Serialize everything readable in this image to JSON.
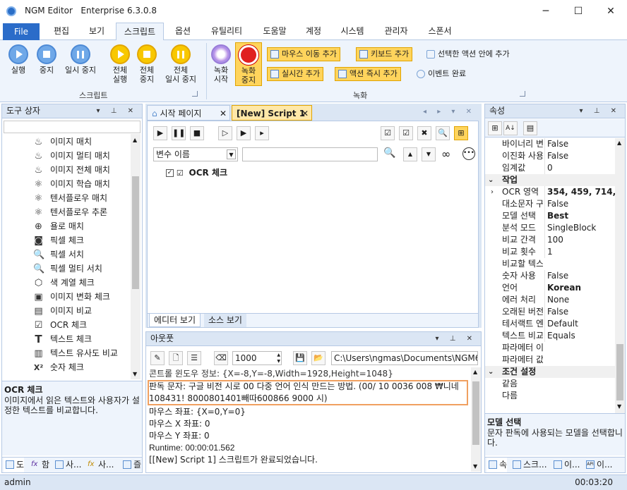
{
  "window": {
    "app": "NGM Editor",
    "edition": "Enterprise 6.3.0.8"
  },
  "window_controls": {
    "minimize": "─",
    "maximize": "☐",
    "close": "✕"
  },
  "menu": {
    "file": "File",
    "tabs": [
      "편집",
      "보기",
      "스크립트",
      "옵션",
      "유틸리티",
      "도움말",
      "계정",
      "시스템",
      "관리자",
      "스폰서"
    ],
    "active": "스크립트"
  },
  "ribbon": {
    "script_group": {
      "label": "스크립트",
      "buttons": [
        "실행",
        "중지",
        "일시 중지"
      ],
      "all_buttons": [
        [
          "전체",
          "실행"
        ],
        [
          "전체",
          "중지"
        ],
        [
          "전체",
          "일시 중지"
        ]
      ]
    },
    "record_group": {
      "label": "녹화",
      "rec_start": [
        "녹화",
        "시작"
      ],
      "rec_stop": [
        "녹화",
        "중지"
      ],
      "small": [
        "마우스 이동 추가",
        "키보드 추가",
        "실시간 추가",
        "액션 즉시 추가"
      ],
      "add_in_action": "선택한 액션 안에 추가",
      "event_done": "이벤트 완료"
    }
  },
  "toolbox": {
    "title": "도구 상자",
    "items": [
      {
        "icon": "♨",
        "label": "이미지 매치"
      },
      {
        "icon": "♨",
        "label": "이미지 멀티 매치"
      },
      {
        "icon": "♨",
        "label": "이미지 전체 매치"
      },
      {
        "icon": "⚛",
        "label": "이미지 학습 매치"
      },
      {
        "icon": "⚛",
        "label": "텐서플로우 매치"
      },
      {
        "icon": "⚛",
        "label": "텐서플로우 추론"
      },
      {
        "icon": "⊕",
        "label": "욜로 매치"
      },
      {
        "icon": "◙",
        "label": "픽셀 체크"
      },
      {
        "icon": "🔍",
        "label": "픽셀 서치"
      },
      {
        "icon": "🔍",
        "label": "픽셀 멀티 서치"
      },
      {
        "icon": "⬡",
        "label": "색 계열 체크"
      },
      {
        "icon": "▣",
        "label": "이미지 변화 체크"
      },
      {
        "icon": "▤",
        "label": "이미지 비교"
      },
      {
        "icon": "☑",
        "label": "OCR 체크"
      },
      {
        "icon": "T",
        "label": "텍스트 체크"
      },
      {
        "icon": "▥",
        "label": "텍스트 유사도 비교"
      },
      {
        "icon": "X²",
        "label": "숫자 체크"
      }
    ],
    "desc_title": "OCR 체크",
    "desc_text": "이미지에서 읽은 텍스트와 사용자가 설정한 텍스트를 비교합니다.",
    "bottom_tabs": [
      "도",
      "함",
      "사...",
      "사...",
      "즐"
    ]
  },
  "editor": {
    "tabs": [
      {
        "label": "시작 페이지"
      },
      {
        "label": "[New] Script 1"
      }
    ],
    "var_select": "변수 이름",
    "node": "OCR 체크",
    "view_tabs": [
      "에디터 보기",
      "소스 보기"
    ]
  },
  "output": {
    "title": "아웃풋",
    "count": "1000",
    "path": "C:\\Users\\ngmas\\Documents\\NGM6\\",
    "lines": [
      "콘트롤 윈도우 정보: {X=-8,Y=-8,Width=1928,Height=1048}",
      "판독 문자: 구글 비전 시로 00 다중 언어 인식 만드는 방법. (00/ 10 0036 008 ₩니네",
      "108431! 8000801401빼따600866 9000 시)",
      "마우스 좌표: {X=0,Y=0}",
      "마우스 X 좌표: 0",
      "마우스 Y 좌표: 0",
      "Runtime: 00:00:01.562",
      "[[New] Script 1] 스크립트가 완료되었습니다."
    ]
  },
  "properties": {
    "title": "속성",
    "rows": [
      {
        "k": "바이너리 변",
        "v": "False",
        "type": "row"
      },
      {
        "k": "이진화 사용",
        "v": "False",
        "type": "row"
      },
      {
        "k": "임계값",
        "v": "0",
        "type": "row"
      },
      {
        "k": "작업",
        "v": "",
        "type": "cat"
      },
      {
        "k": "OCR 영역",
        "v": "354, 459, 714, 3",
        "type": "row",
        "bold": true,
        "arrow": true
      },
      {
        "k": "대소문자 구",
        "v": "False",
        "type": "row"
      },
      {
        "k": "모델 선택",
        "v": "Best",
        "type": "row",
        "bold": true
      },
      {
        "k": "분석 모드",
        "v": "SingleBlock",
        "type": "row"
      },
      {
        "k": "비교 간격",
        "v": "100",
        "type": "row"
      },
      {
        "k": "비교 횟수",
        "v": "1",
        "type": "row"
      },
      {
        "k": "비교할 텍스",
        "v": "",
        "type": "row"
      },
      {
        "k": "숫자 사용",
        "v": "False",
        "type": "row"
      },
      {
        "k": "언어",
        "v": "Korean",
        "type": "row",
        "bold": true
      },
      {
        "k": "에러 처리",
        "v": "None",
        "type": "row"
      },
      {
        "k": "오래된 버전",
        "v": "False",
        "type": "row"
      },
      {
        "k": "테서랙트 엔",
        "v": "Default",
        "type": "row"
      },
      {
        "k": "텍스트 비교",
        "v": "Equals",
        "type": "row"
      },
      {
        "k": "파라메터 이",
        "v": "",
        "type": "row"
      },
      {
        "k": "파라메터 값",
        "v": "",
        "type": "row"
      },
      {
        "k": "조건 설정",
        "v": "",
        "type": "cat"
      },
      {
        "k": "같음",
        "v": "",
        "type": "row"
      },
      {
        "k": "다름",
        "v": "",
        "type": "row"
      }
    ],
    "desc_title": "모델 선택",
    "desc_text": "문자 판독에 사용되는 모델을 선택합니다.",
    "bottom_tabs": [
      "속",
      "스크...",
      "이...",
      "이..."
    ]
  },
  "status": {
    "user": "admin",
    "time": "00:03:20"
  }
}
